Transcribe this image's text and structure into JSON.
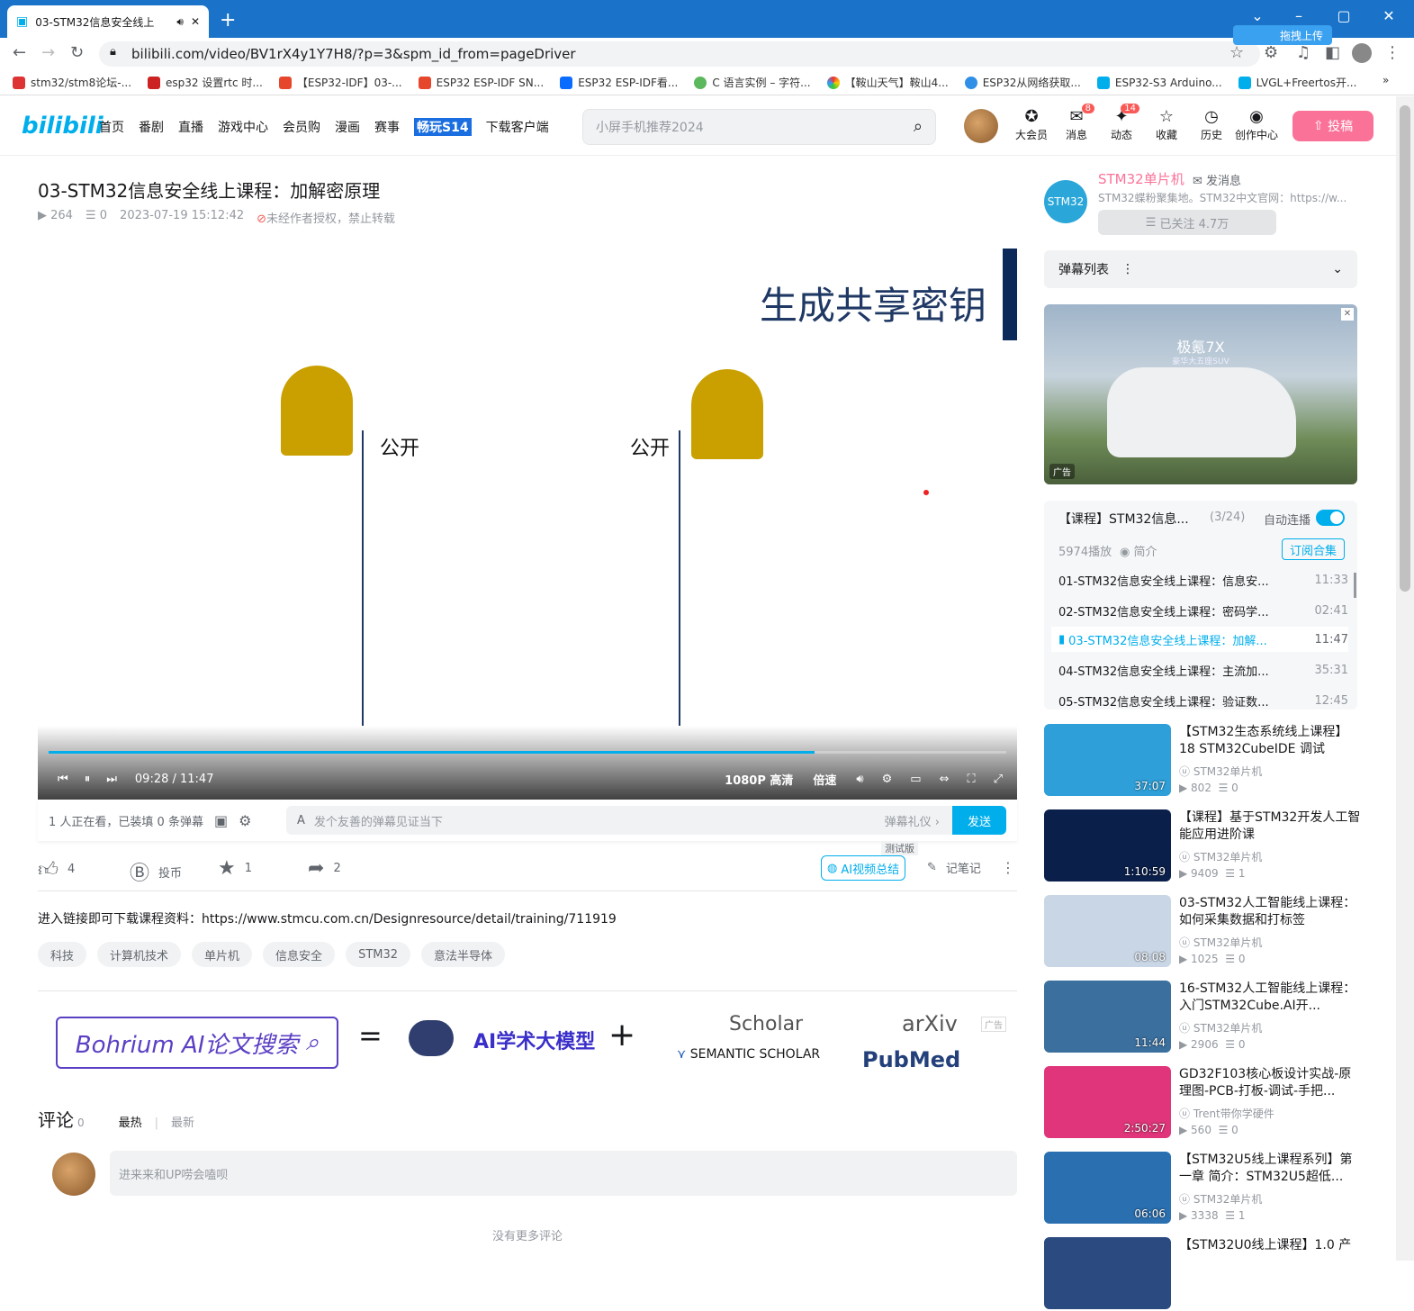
{
  "browser": {
    "tab_title": "03-STM32信息安全线上",
    "url": "bilibili.com/video/BV1rX4y1Y7H8/?p=3&spm_id_from=pageDriver",
    "upload_chip": "拖拽上传",
    "bookmarks": [
      "stm32/stm8论坛-...",
      "esp32 设置rtc 时...",
      "【ESP32-IDF】03-...",
      "ESP32 ESP-IDF SN...",
      "ESP32 ESP-IDF看...",
      "C 语言实例 – 字符...",
      "【鞍山天气】鞍山4...",
      "ESP32从网络获取...",
      "ESP32-S3 Arduino...",
      "LVGL+Freertos开..."
    ]
  },
  "header": {
    "logo": "bilibili",
    "nav": [
      "首页",
      "番剧",
      "直播",
      "游戏中心",
      "会员购",
      "漫画",
      "赛事",
      "畅玩S14",
      "下载客户端"
    ],
    "search_placeholder": "小屏手机推荐2024",
    "icons": [
      {
        "label": "大会员",
        "glyph": "✪",
        "badge": ""
      },
      {
        "label": "消息",
        "glyph": "✉",
        "badge": "8"
      },
      {
        "label": "动态",
        "glyph": "✦",
        "badge": "14"
      },
      {
        "label": "收藏",
        "glyph": "☆",
        "badge": ""
      },
      {
        "label": "历史",
        "glyph": "◷",
        "badge": ""
      },
      {
        "label": "创作中心",
        "glyph": "◉",
        "badge": ""
      }
    ],
    "upload": "投稿"
  },
  "video": {
    "title": "03-STM32信息安全线上课程：加解密原理",
    "views": "264",
    "danmaku": "0",
    "date": "2023-07-19 15:12:42",
    "copyright": "未经作者授权，禁止转载",
    "slide_title": "生成共享密钥",
    "slide_left_label": "公开",
    "slide_right_label": "公开",
    "time": "09:28 / 11:47",
    "progress": 0.8,
    "quality": "1080P 高清",
    "speed": "倍速"
  },
  "danmaku_bar": {
    "status": "1 人正在看，已装填 0 条弹幕",
    "placeholder": "发个友善的弹幕见证当下",
    "etiquette": "弹幕礼仪 ›",
    "send": "发送"
  },
  "toolbar": {
    "like": "4",
    "coin": "投币",
    "fav": "1",
    "share": "2",
    "ai_summary": "AI视频总结",
    "beta": "测试版",
    "notes": "记笔记"
  },
  "description": "进入链接即可下载课程资料：https://www.stmcu.com.cn/Designresource/detail/training/711919",
  "tags": [
    "科技",
    "计算机技术",
    "单片机",
    "信息安全",
    "STM32",
    "意法半导体"
  ],
  "banner": {
    "left": "Bohrium AI论文搜索",
    "eq": "=",
    "model": "AI学术大模型",
    "plus": "+",
    "scholar": "Scholar",
    "semantic": "SEMANTIC SCHOLAR",
    "arxiv": "arXiv",
    "pubmed": "PubMed",
    "ad": "广告"
  },
  "comments": {
    "label": "评论",
    "count": "0",
    "sort_hot": "最热",
    "sort_new": "最新",
    "placeholder": "进来来和UP唠会嗑呗",
    "no_more": "没有更多评论"
  },
  "uploader": {
    "name": "STM32单片机",
    "message": "发消息",
    "desc": "STM32蝶粉聚集地。STM32中文官网：https://w...",
    "follow": "已关注 4.7万",
    "avatar_text": "STM32"
  },
  "danmaku_list": "弹幕列表",
  "ad": {
    "brand": "极氪7X",
    "tagline": "豪华大五座SUV",
    "label": "广告"
  },
  "playlist": {
    "title": "【课程】STM32信息...",
    "progress": "(3/24)",
    "autoplay": "自动连播",
    "plays": "5974播放",
    "intro": "简介",
    "subscribe": "订阅合集",
    "items": [
      {
        "name": "01-STM32信息安全线上课程：信息安...",
        "dur": "11:33",
        "active": false
      },
      {
        "name": "02-STM32信息安全线上课程：密码学...",
        "dur": "02:41",
        "active": false
      },
      {
        "name": "03-STM32信息安全线上课程：加解...",
        "dur": "11:47",
        "active": true
      },
      {
        "name": "04-STM32信息安全线上课程：主流加...",
        "dur": "35:31",
        "active": false
      },
      {
        "name": "05-STM32信息安全线上课程：验证数...",
        "dur": "12:45",
        "active": false
      }
    ]
  },
  "recommendations": [
    {
      "title": "【STM32生态系统线上课程】18 STM32CubeIDE 调试",
      "up": "STM32单片机",
      "views": "802",
      "danmaku": "0",
      "dur": "37:07",
      "color": "#2e9fd8"
    },
    {
      "title": "【课程】基于STM32开发人工智能应用进阶课",
      "up": "STM32单片机",
      "views": "9409",
      "danmaku": "1",
      "dur": "1:10:59",
      "color": "#0a1f4a"
    },
    {
      "title": "03-STM32人工智能线上课程：如何采集数据和打标签",
      "up": "STM32单片机",
      "views": "1025",
      "danmaku": "0",
      "dur": "08:08",
      "color": "#c9d6e6"
    },
    {
      "title": "16-STM32人工智能线上课程：入门STM32Cube.AI开...",
      "up": "STM32单片机",
      "views": "2906",
      "danmaku": "0",
      "dur": "11:44",
      "color": "#3a6f9e"
    },
    {
      "title": "GD32F103核心板设计实战-原理图-PCB-打板-调试-手把...",
      "up": "Trent带你学硬件",
      "views": "560",
      "danmaku": "0",
      "dur": "2:50:27",
      "color": "#e0357a"
    },
    {
      "title": "【STM32U5线上课程系列】第一章 简介：STM32U5超低...",
      "up": "STM32单片机",
      "views": "3338",
      "danmaku": "1",
      "dur": "06:06",
      "color": "#2a6fb0"
    },
    {
      "title": "【STM32U0线上课程】1.0 产",
      "up": "",
      "views": "",
      "danmaku": "",
      "dur": "",
      "color": "#2a4a80"
    }
  ]
}
